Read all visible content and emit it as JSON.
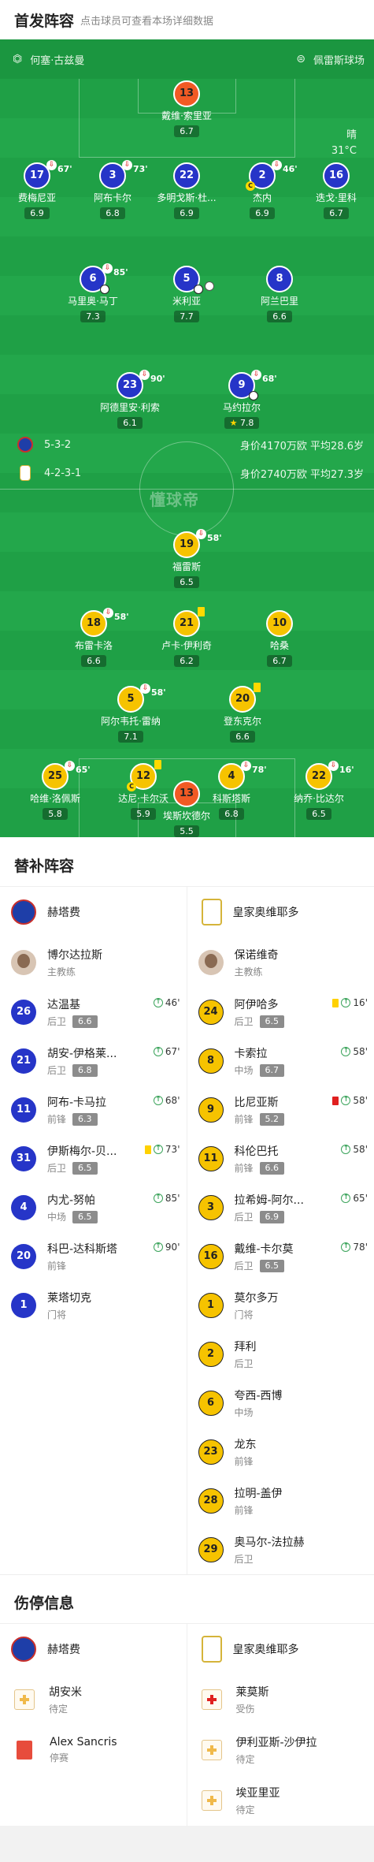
{
  "lineup": {
    "title": "首发阵容",
    "subtitle": "点击球员可查看本场详细数据"
  },
  "pitch": {
    "referee": "何塞·古兹曼",
    "stadium": "佩雷斯球场",
    "watermark": "懂球帝",
    "weather": "晴",
    "temperature": "31°C",
    "home_team": {
      "formation": "5-3-2",
      "info": "身价4170万欧 平均28.6岁"
    },
    "away_team": {
      "formation": "4-2-3-1",
      "info": "身价2740万欧 平均27.3岁"
    }
  },
  "home_players": [
    {
      "num": "13",
      "name": "戴维·索里亚",
      "rating": "6.7",
      "gk": true
    },
    {
      "num": "17",
      "name": "费梅尼亚",
      "rating": "6.9",
      "sub": "67'"
    },
    {
      "num": "3",
      "name": "阿布卡尔",
      "rating": "6.8",
      "sub": "73'"
    },
    {
      "num": "22",
      "name": "多明戈斯·杜...",
      "rating": "6.9"
    },
    {
      "num": "2",
      "name": "杰内",
      "rating": "6.9",
      "sub": "46'"
    },
    {
      "num": "16",
      "name": "迭戈·里科",
      "rating": "6.7"
    },
    {
      "num": "6",
      "name": "马里奥·马丁",
      "rating": "7.3",
      "sub": "85'"
    },
    {
      "num": "5",
      "name": "米利亚",
      "rating": "7.7"
    },
    {
      "num": "8",
      "name": "阿兰巴里",
      "rating": "6.6"
    },
    {
      "num": "23",
      "name": "阿德里安·利索",
      "rating": "6.1",
      "sub": "90'"
    },
    {
      "num": "9",
      "name": "马约拉尔",
      "rating": "7.8",
      "sub": "68'"
    }
  ],
  "away_players": [
    {
      "num": "19",
      "name": "福雷斯",
      "rating": "6.5",
      "sub": "58'"
    },
    {
      "num": "18",
      "name": "布雷卡洛",
      "rating": "6.6",
      "sub": "58'"
    },
    {
      "num": "21",
      "name": "卢卡·伊利奇",
      "rating": "6.2"
    },
    {
      "num": "10",
      "name": "哈桑",
      "rating": "6.7"
    },
    {
      "num": "5",
      "name": "阿尔韦托·雷纳",
      "rating": "7.1",
      "sub": "58'"
    },
    {
      "num": "20",
      "name": "登东克尔",
      "rating": "6.6"
    },
    {
      "num": "25",
      "name": "哈维·洛佩斯",
      "rating": "5.8",
      "sub": "65'"
    },
    {
      "num": "12",
      "name": "达尼·卡尔沃",
      "rating": "5.9"
    },
    {
      "num": "4",
      "name": "科斯塔斯",
      "rating": "6.8",
      "sub": "78'"
    },
    {
      "num": "22",
      "name": "纳乔·比达尔",
      "rating": "6.5",
      "sub": "16'"
    },
    {
      "num": "13",
      "name": "埃斯坎德尔",
      "rating": "5.5",
      "gk": true
    }
  ],
  "subs": {
    "title": "替补阵容",
    "home_team": "赫塔费",
    "away_team": "皇家奥维耶多",
    "home_coach": {
      "name": "博尔达拉斯",
      "role": "主教练"
    },
    "away_coach": {
      "name": "保诺维奇",
      "role": "主教练"
    },
    "home": [
      {
        "num": "26",
        "name": "达温基",
        "pos": "后卫",
        "rating": "6.6",
        "in": "46'"
      },
      {
        "num": "21",
        "name": "胡安-伊格莱...",
        "pos": "后卫",
        "rating": "6.8",
        "in": "67'"
      },
      {
        "num": "11",
        "name": "阿布-卡马拉",
        "pos": "前锋",
        "rating": "6.3",
        "in": "68'"
      },
      {
        "num": "31",
        "name": "伊斯梅尔-贝...",
        "pos": "后卫",
        "rating": "6.5",
        "in": "73'"
      },
      {
        "num": "4",
        "name": "内尤-努帕",
        "pos": "中场",
        "rating": "6.5",
        "in": "85'"
      },
      {
        "num": "20",
        "name": "科巴-达科斯塔",
        "pos": "前锋",
        "rating": "",
        "in": "90'"
      },
      {
        "num": "1",
        "name": "莱塔切克",
        "pos": "门将",
        "rating": "",
        "in": ""
      }
    ],
    "away": [
      {
        "num": "24",
        "name": "阿伊哈多",
        "pos": "后卫",
        "rating": "6.5",
        "in": "16'"
      },
      {
        "num": "8",
        "name": "卡索拉",
        "pos": "中场",
        "rating": "6.7",
        "in": "58'"
      },
      {
        "num": "9",
        "name": "比尼亚斯",
        "pos": "前锋",
        "rating": "5.2",
        "in": "58'"
      },
      {
        "num": "11",
        "name": "科伦巴托",
        "pos": "前锋",
        "rating": "6.6",
        "in": "58'"
      },
      {
        "num": "3",
        "name": "拉希姆-阿尔...",
        "pos": "后卫",
        "rating": "6.9",
        "in": "65'"
      },
      {
        "num": "16",
        "name": "戴维-卡尔莫",
        "pos": "后卫",
        "rating": "6.5",
        "in": "78'"
      },
      {
        "num": "1",
        "name": "莫尔多万",
        "pos": "门将",
        "rating": "",
        "in": ""
      },
      {
        "num": "2",
        "name": "拜利",
        "pos": "后卫",
        "rating": "",
        "in": ""
      },
      {
        "num": "6",
        "name": "夸西-西博",
        "pos": "中场",
        "rating": "",
        "in": ""
      },
      {
        "num": "23",
        "name": "龙东",
        "pos": "前锋",
        "rating": "",
        "in": ""
      },
      {
        "num": "28",
        "name": "拉明-盖伊",
        "pos": "前锋",
        "rating": "",
        "in": ""
      },
      {
        "num": "29",
        "name": "奥马尔-法拉赫",
        "pos": "后卫",
        "rating": "",
        "in": ""
      }
    ]
  },
  "injuries": {
    "title": "伤停信息",
    "home_team": "赫塔费",
    "away_team": "皇家奥维耶多",
    "home": [
      {
        "name": "胡安米",
        "status": "待定",
        "icon": "medkit-icon"
      },
      {
        "name": "Alex Sancris",
        "status": "停赛",
        "icon": "red-card-icon"
      }
    ],
    "away": [
      {
        "name": "莱莫斯",
        "status": "受伤",
        "icon": "medkit-red-icon"
      },
      {
        "name": "伊利亚斯-沙伊拉",
        "status": "待定",
        "icon": "medkit-icon"
      },
      {
        "name": "埃亚里亚",
        "status": "待定",
        "icon": "medkit-icon"
      }
    ]
  }
}
